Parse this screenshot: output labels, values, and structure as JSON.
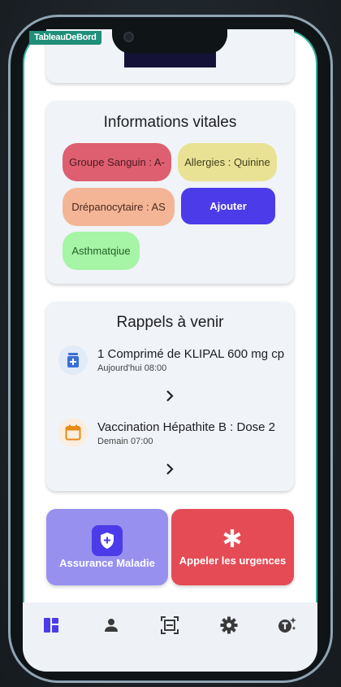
{
  "debug_banner": "TableauDeBord",
  "vitals": {
    "title": "Informations vitales",
    "blood_group": "Groupe Sanguin : A-",
    "allergies": "Allergies : Quinine",
    "sickle_cell": "Drépanocytaire  : AS",
    "add_label": "Ajouter",
    "asthma": "Asthmatqiue"
  },
  "reminders": {
    "title": "Rappels à venir",
    "items": [
      {
        "title": "1 Comprimé de KLIPAL 600 mg cp",
        "time": "Aujourd'hui 08:00",
        "icon": "pill-bottle-icon"
      },
      {
        "title": "Vaccination Hépathite B : Dose 2",
        "time": "Demain 07:00",
        "icon": "calendar-icon"
      }
    ]
  },
  "actions": {
    "insurance_label": "Assurance Maladie",
    "emergency_label": "Appeler les urgences"
  },
  "nav": {
    "items": [
      "dashboard-icon",
      "person-icon",
      "scan-icon",
      "gear-icon",
      "translate-icon"
    ],
    "active": "dashboard-icon"
  },
  "colors": {
    "accent": "#4c3be8",
    "blood_chip": "#de5f6f",
    "allergy_chip": "#e9e294",
    "sickle_chip": "#f4b596",
    "asthma_chip": "#a6f4a5",
    "insurance_tile": "#9890ef",
    "emergency_tile": "#e54b55"
  }
}
